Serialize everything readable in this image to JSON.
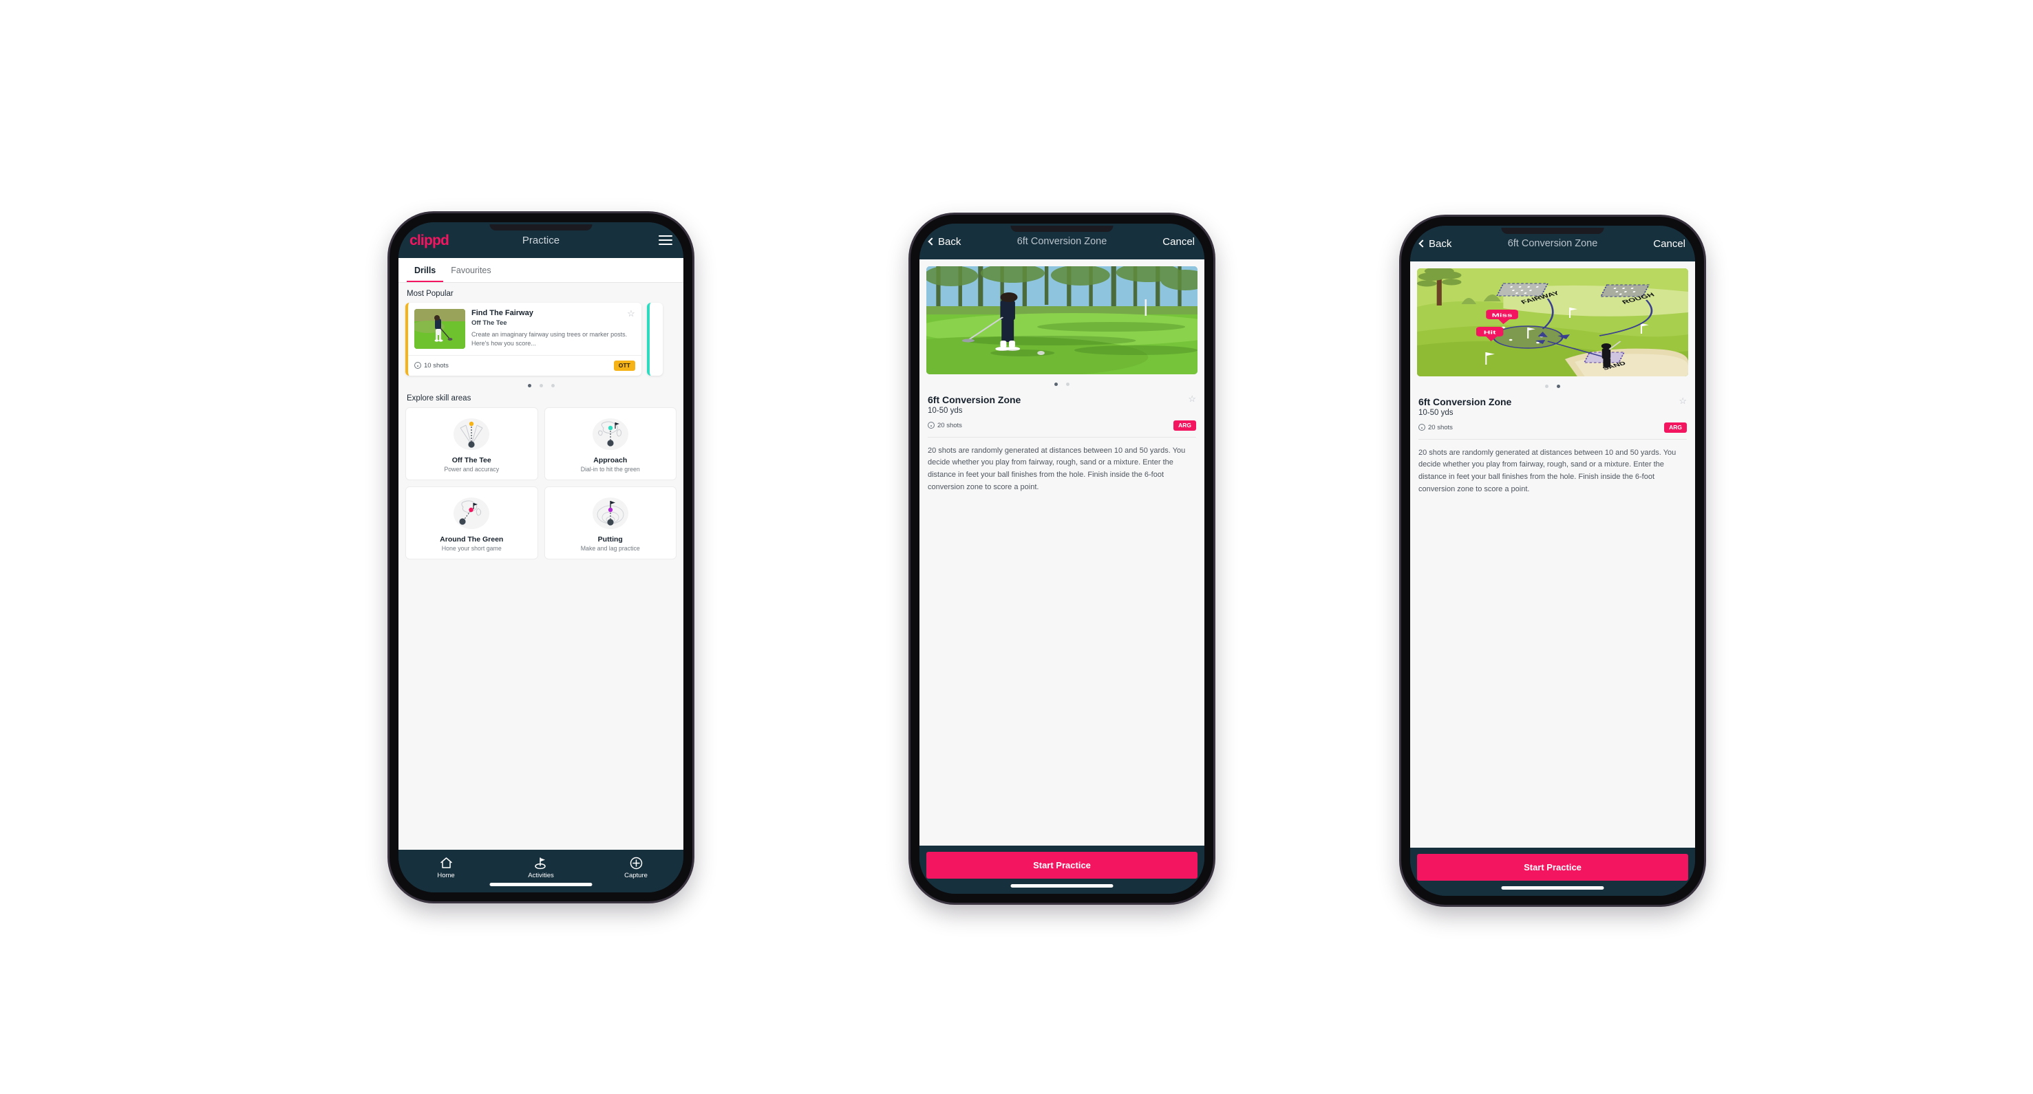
{
  "phone1": {
    "appbar": {
      "brand": "clippd",
      "title": "Practice",
      "menu_icon": "hamburger-icon"
    },
    "tabs": [
      {
        "label": "Drills",
        "active": true
      },
      {
        "label": "Favourites",
        "active": false
      }
    ],
    "most_popular": {
      "section_title": "Most Popular",
      "card": {
        "name": "Find The Fairway",
        "sub": "Off The Tee",
        "desc": "Create an imaginary fairway using trees or marker posts. Here's how you score...",
        "shots": "10 shots",
        "badge": "OTT",
        "badge_color": "#f5b318",
        "star_icon": "star-outline-icon",
        "accent_color": "#f5b318"
      },
      "peek_accent_color": "#2fdbc0",
      "dots": {
        "count": 3,
        "active_index": 0
      }
    },
    "skills": {
      "section_title": "Explore skill areas",
      "items": [
        {
          "name": "Off The Tee",
          "desc": "Power and accuracy",
          "icon": "tee-fan-icon",
          "accent": "#f5b318"
        },
        {
          "name": "Approach",
          "desc": "Dial-in to hit the green",
          "icon": "approach-green-icon",
          "accent": "#2fdbc0"
        },
        {
          "name": "Around The Green",
          "desc": "Hone your short game",
          "icon": "around-green-icon",
          "accent": "#f31560"
        },
        {
          "name": "Putting",
          "desc": "Make and lag practice",
          "icon": "putting-rings-icon",
          "accent": "#b026d3"
        }
      ]
    },
    "tabbar": [
      {
        "label": "Home",
        "icon": "home-icon",
        "active": false
      },
      {
        "label": "Activities",
        "icon": "golf-flag-icon",
        "active": true
      },
      {
        "label": "Capture",
        "icon": "plus-circle-icon",
        "active": false
      }
    ]
  },
  "phone2": {
    "navbar": {
      "back": "Back",
      "title": "6ft Conversion Zone",
      "cancel": "Cancel",
      "back_icon": "chevron-left-icon"
    },
    "hero": {
      "kind": "photo",
      "alt": "golfer-chipping-photo"
    },
    "dots": {
      "count": 2,
      "active_index": 0
    },
    "detail": {
      "title": "6ft Conversion Zone",
      "yards": "10-50 yds",
      "shots": "20 shots",
      "badge": "ARG",
      "badge_color": "#f31560",
      "star_icon": "star-outline-icon",
      "description": "20 shots are randomly generated at distances between 10 and 50 yards. You decide whether you play from fairway, rough, sand or a mixture. Enter the distance in feet your ball finishes from the hole. Finish inside the 6-foot conversion zone to score a point."
    },
    "cta": "Start Practice"
  },
  "phone3": {
    "navbar": {
      "back": "Back",
      "title": "6ft Conversion Zone",
      "cancel": "Cancel",
      "back_icon": "chevron-left-icon"
    },
    "hero": {
      "kind": "diagram",
      "alt": "golf-course-diagram",
      "labels": {
        "fairway": "FAIRWAY",
        "rough": "ROUGH",
        "sand": "SAND",
        "miss": "Miss",
        "hit": "Hit"
      }
    },
    "dots": {
      "count": 2,
      "active_index": 1
    },
    "detail": {
      "title": "6ft Conversion Zone",
      "yards": "10-50 yds",
      "shots": "20 shots",
      "badge": "ARG",
      "badge_color": "#f31560",
      "star_icon": "star-outline-icon",
      "description": "20 shots are randomly generated at distances between 10 and 50 yards. You decide whether you play from fairway, rough, sand or a mixture. Enter the distance in feet your ball finishes from the hole. Finish inside the 6-foot conversion zone to score a point."
    },
    "cta": "Start Practice"
  }
}
